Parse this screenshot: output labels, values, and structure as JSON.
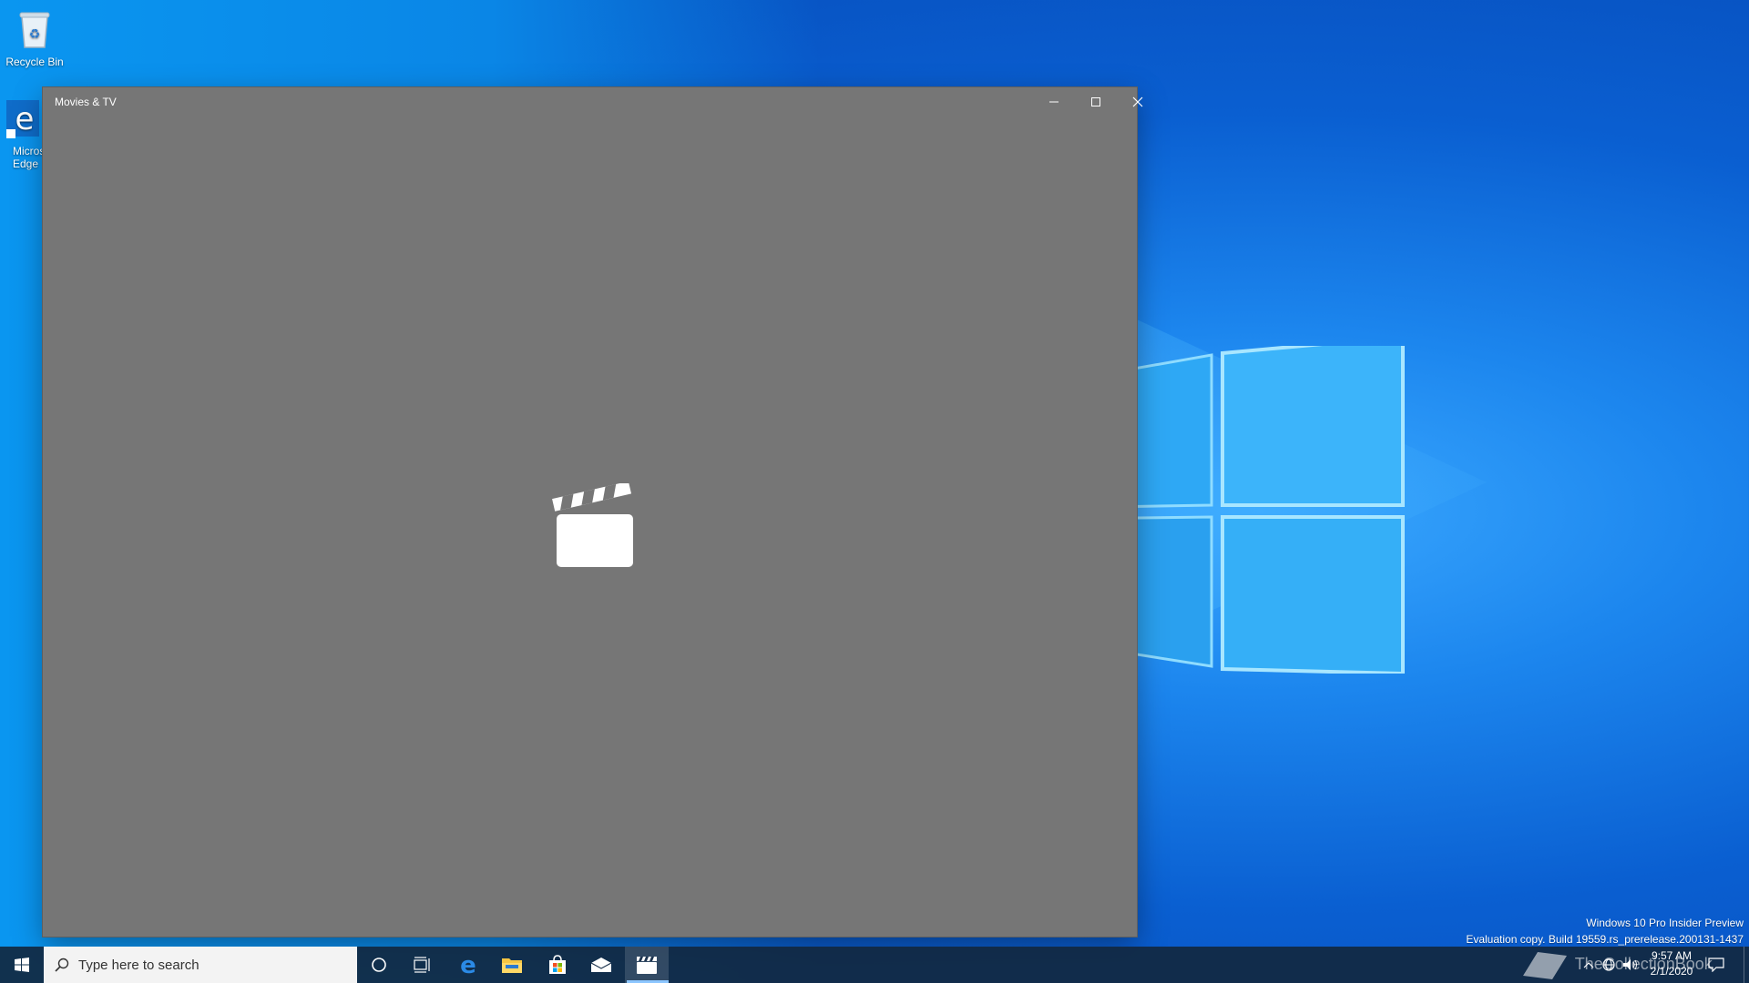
{
  "desktop": {
    "icons": [
      {
        "label": "Recycle Bin"
      },
      {
        "label": "Micros\nEdge"
      }
    ],
    "watermark_lines": [
      "Windows 10 Pro Insider Preview",
      "Evaluation copy. Build 19559.rs_prerelease.200131-1437"
    ],
    "brand_watermark": "TheCollectionBook"
  },
  "window": {
    "title": "Movies & TV",
    "controls": {
      "minimize": "minimize-icon",
      "maximize": "maximize-icon",
      "close": "close-icon"
    },
    "background_color": "#767676",
    "splash_icon": "clapperboard-icon"
  },
  "taskbar": {
    "start_icon": "windows-start-icon",
    "search": {
      "placeholder": "Type here to search"
    },
    "pinned": [
      {
        "name": "cortana-icon"
      },
      {
        "name": "task-view-icon"
      },
      {
        "name": "edge-icon"
      },
      {
        "name": "file-explorer-icon"
      },
      {
        "name": "microsoft-store-icon"
      },
      {
        "name": "mail-icon"
      },
      {
        "name": "movies-tv-icon",
        "active": true
      }
    ],
    "tray": {
      "time": "9:57 AM",
      "date": "2/1/2020",
      "icons": [
        "chevron-up-icon",
        "network-icon",
        "volume-icon",
        "notification-icon"
      ]
    }
  }
}
